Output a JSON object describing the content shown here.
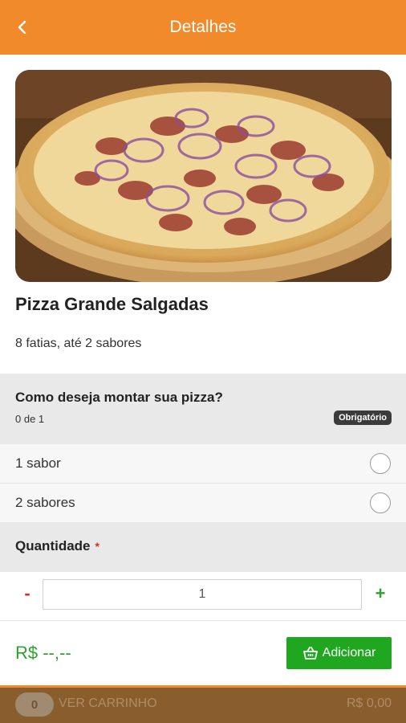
{
  "header": {
    "title": "Detalhes",
    "back_icon": "chevron-left-icon"
  },
  "product": {
    "name": "Pizza Grande Salgadas",
    "description": "8 fatias, até 2 sabores",
    "image": "pizza-photo"
  },
  "option_group": {
    "question": "Como deseja montar sua pizza?",
    "count": "0 de 1",
    "badge": "Obrigatório",
    "options": [
      {
        "label": "1 sabor"
      },
      {
        "label": "2 sabores"
      }
    ]
  },
  "quantity": {
    "label": "Quantidade",
    "required_mark": "*",
    "minus": "-",
    "plus": "+",
    "value": "1"
  },
  "summary": {
    "price": "R$ --,--",
    "add_label": "Adicionar",
    "add_icon": "basket-icon"
  },
  "footer": {
    "cart_count": "0",
    "cart_label": "VER CARRINHO",
    "total": "R$ 0,00"
  },
  "colors": {
    "primary": "#F08A2A",
    "green": "#1FA81F",
    "red": "#d32f2f"
  }
}
